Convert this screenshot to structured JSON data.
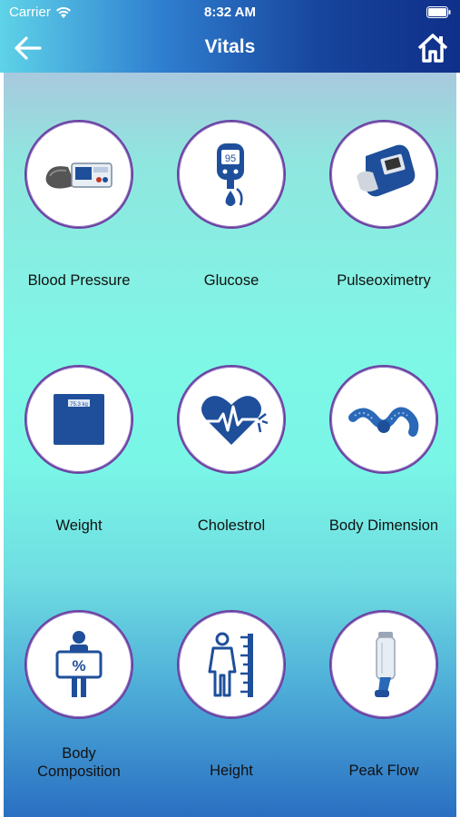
{
  "status_bar": {
    "carrier": "Carrier",
    "time": "8:32 AM",
    "wifi_icon": "wifi-icon",
    "battery_icon": "battery-icon"
  },
  "nav": {
    "title": "Vitals",
    "back_icon": "arrow-left-icon",
    "home_icon": "home-icon"
  },
  "colors": {
    "header_start": "#5ed3e8",
    "header_end": "#0f2f8a",
    "icon_blue": "#1f4f9a",
    "circle_border": "#6b3fa0"
  },
  "tiles": [
    {
      "label": "Blood Pressure",
      "icon": "blood-pressure-monitor-icon"
    },
    {
      "label": "Glucose",
      "icon": "glucose-meter-icon"
    },
    {
      "label": "Pulseoximetry",
      "icon": "pulse-oximeter-icon"
    },
    {
      "label": "Weight",
      "icon": "weighing-scale-icon"
    },
    {
      "label": "Cholestrol",
      "icon": "heart-pulse-icon"
    },
    {
      "label": "Body Dimension",
      "icon": "measuring-tape-icon"
    },
    {
      "label": "Body\nComposition",
      "icon": "body-composition-icon"
    },
    {
      "label": "Height",
      "icon": "height-measure-icon"
    },
    {
      "label": "Peak Flow",
      "icon": "peak-flow-meter-icon"
    }
  ]
}
